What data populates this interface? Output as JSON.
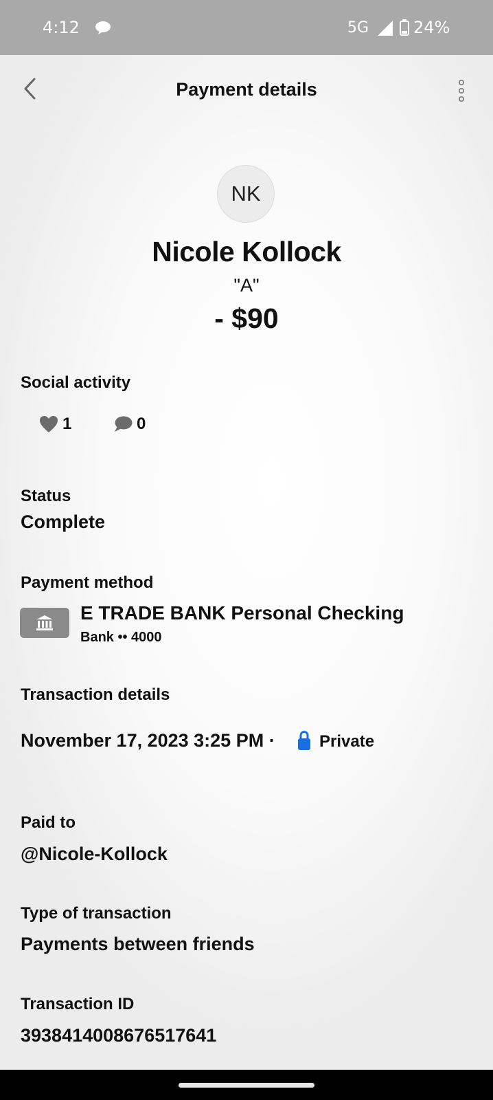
{
  "status_bar": {
    "time": "4:12",
    "network": "5G",
    "battery": "24%",
    "icons": [
      "chat-bubble-icon",
      "signal-icon",
      "battery-icon"
    ]
  },
  "header": {
    "title": "Payment details",
    "back_icon": "chevron-left-icon",
    "more_icon": "vertical-dots-icon"
  },
  "recipient": {
    "initials": "NK",
    "name": "Nicole Kollock",
    "note": "\"A\"",
    "amount": "- $90"
  },
  "social": {
    "label": "Social activity",
    "likes": "1",
    "comments": "0"
  },
  "status": {
    "label": "Status",
    "value": "Complete"
  },
  "payment_method": {
    "label": "Payment method",
    "bank_name": "E TRADE BANK Personal Checking",
    "bank_sub": "Bank •• 4000",
    "icon": "bank-icon"
  },
  "transaction_details": {
    "label": "Transaction details",
    "date": "November 17, 2023 3:25 PM ·",
    "privacy": "Private",
    "privacy_color": "#1a6fe0"
  },
  "paid_to": {
    "label": "Paid to",
    "value": "@Nicole-Kollock"
  },
  "transaction_type": {
    "label": "Type of transaction",
    "value": "Payments between friends"
  },
  "transaction_id": {
    "label": "Transaction ID",
    "value": "3938414008676517641"
  }
}
